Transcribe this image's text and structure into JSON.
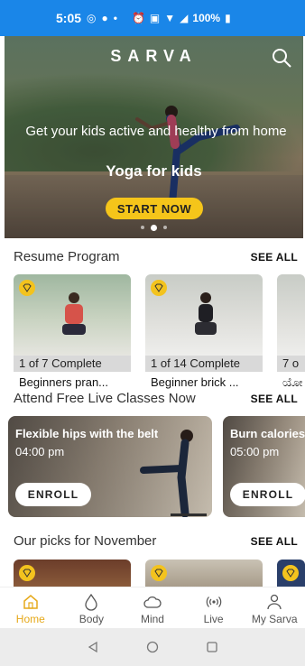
{
  "status_bar": {
    "time": "5:05",
    "battery": "100%"
  },
  "hero": {
    "brand": "SARVA",
    "subtitle": "Get your kids active and healthy from home",
    "title": "Yoga for kids",
    "cta": "START NOW",
    "slide_count": 3,
    "active_slide": 1
  },
  "resume": {
    "title": "Resume Program",
    "see_all": "SEE ALL",
    "items": [
      {
        "progress": "1 of 7 Complete",
        "name": "Beginners pran..."
      },
      {
        "progress": "1 of 14 Complete",
        "name": "Beginner brick ..."
      },
      {
        "progress": "7 o",
        "name": "ಯೋ"
      }
    ]
  },
  "live": {
    "title": "Attend Free Live Classes Now",
    "see_all": "SEE ALL",
    "items": [
      {
        "title": "Flexible hips with the belt",
        "time": "04:00 pm",
        "cta": "ENROLL"
      },
      {
        "title": "Burn calories",
        "time": "05:00 pm",
        "cta": "ENROLL"
      }
    ]
  },
  "picks": {
    "title": "Our picks for November",
    "see_all": "SEE ALL"
  },
  "bottom_nav": {
    "items": [
      {
        "label": "Home",
        "icon": "home-icon",
        "active": true
      },
      {
        "label": "Body",
        "icon": "drop-icon"
      },
      {
        "label": "Mind",
        "icon": "cloud-icon"
      },
      {
        "label": "Live",
        "icon": "broadcast-icon"
      },
      {
        "label": "My Sarva",
        "icon": "person-icon"
      }
    ]
  },
  "colors": {
    "accent": "#f5c51a",
    "status_bar": "#1a86e8",
    "active_nav": "#e6a91a"
  }
}
